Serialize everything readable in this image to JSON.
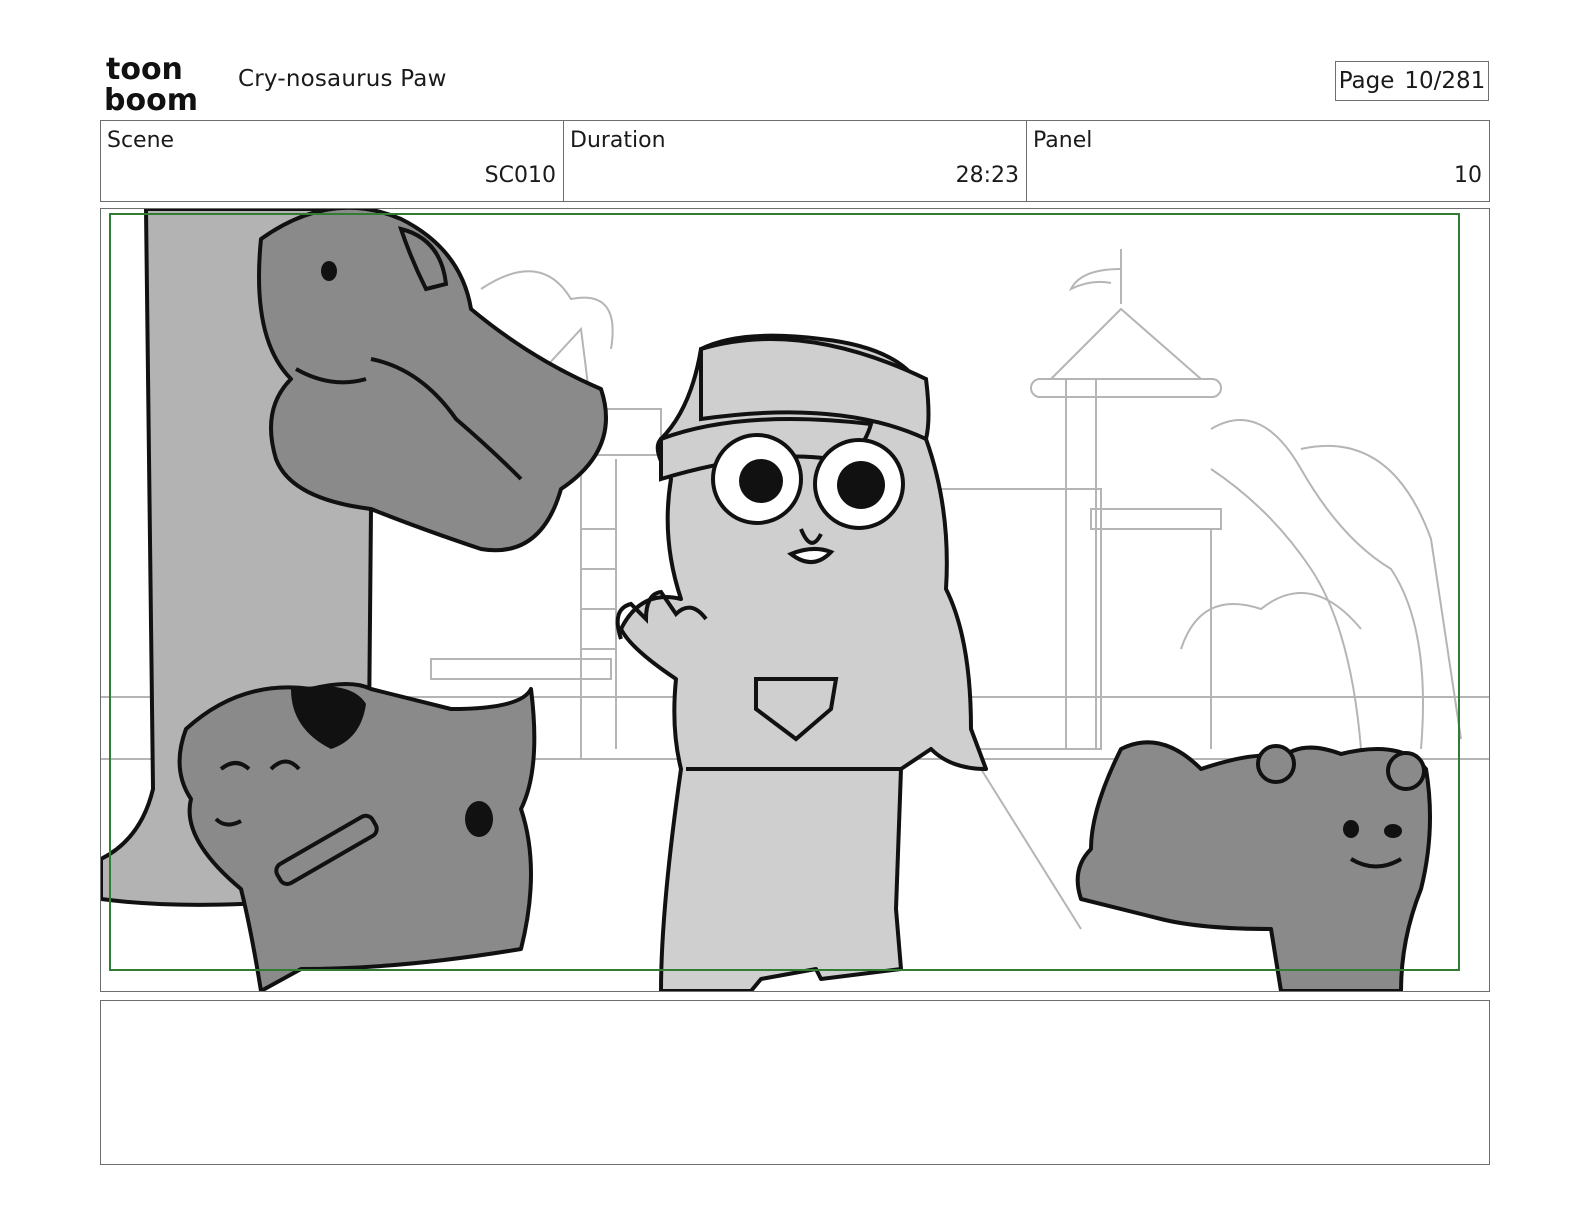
{
  "header": {
    "logo_line1": "toon",
    "logo_line2": "boom",
    "project_title": "Cry-nosaurus Paw",
    "page_label": "Page",
    "page_value": "10/281"
  },
  "info": {
    "scene_label": "Scene",
    "scene_value": "SC010",
    "duration_label": "Duration",
    "duration_value": "28:23",
    "panel_label": "Panel",
    "panel_value": "10"
  },
  "panel": {
    "safe_area_color": "#2e7d32",
    "fill_dark": "#8a8a8a",
    "fill_mid": "#a8a8a8",
    "fill_light": "#cfcfcf",
    "line_color": "#111111",
    "bg_line_color": "#b5b5b5"
  },
  "notes": {
    "text": ""
  }
}
